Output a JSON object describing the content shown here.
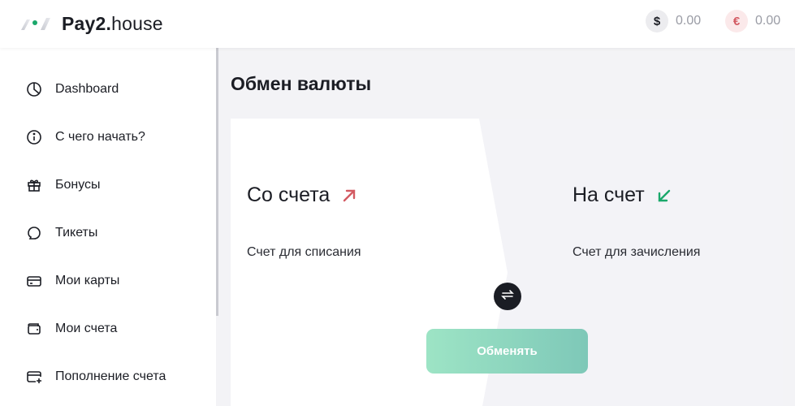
{
  "header": {
    "logo_bold": "Pay2",
    "logo_dot": ".",
    "logo_light": "house",
    "balances": [
      {
        "currency_symbol": "$",
        "amount": "0.00"
      },
      {
        "currency_symbol": "€",
        "amount": "0.00"
      }
    ]
  },
  "sidebar": {
    "items": [
      {
        "label": "Dashboard",
        "icon": "pie-chart-icon"
      },
      {
        "label": "С чего начать?",
        "icon": "info-circle-icon"
      },
      {
        "label": "Бонусы",
        "icon": "gift-icon"
      },
      {
        "label": "Тикеты",
        "icon": "chat-bubble-icon"
      },
      {
        "label": "Мои карты",
        "icon": "credit-card-icon"
      },
      {
        "label": "Мои счета",
        "icon": "wallet-icon"
      },
      {
        "label": "Пополнение счета",
        "icon": "card-add-icon"
      }
    ]
  },
  "main": {
    "title": "Обмен валюты",
    "from": {
      "title": "Со счета",
      "subtitle": "Счет для списания"
    },
    "to": {
      "title": "На счет",
      "subtitle": "Счет для зачисления"
    },
    "submit_label": "Обменять"
  },
  "colors": {
    "accent_green": "#1aa86b",
    "accent_red": "#d35a62",
    "button_gradient_start": "#9de4c5",
    "button_gradient_end": "#7ec8b8",
    "dark": "#1b1d24"
  }
}
